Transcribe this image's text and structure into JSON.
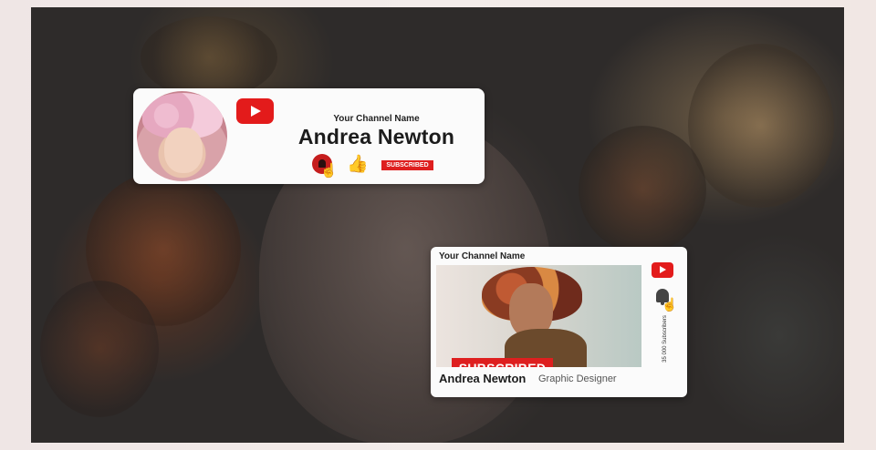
{
  "colors": {
    "accent_red": "#de1f1f",
    "youtube_red": "#e31b1b",
    "like_blue": "#3c7fd2",
    "card_bg": "#fbfbfb",
    "backdrop": "#2e2b2a"
  },
  "icons": {
    "youtube": "youtube-logo-icon",
    "bell": "notification-bell-icon",
    "like": "thumbs-up-icon",
    "cursor": "hand-pointer-icon"
  },
  "card_top": {
    "channel_label": "Your Channel Name",
    "name": "Andrea Newton",
    "subscribe_label": "SUBSCRIBED",
    "like_glyph": "👍",
    "cursor_glyph": "☝"
  },
  "card_bottom": {
    "channel_label": "Your Channel Name",
    "subscribe_label": "SUBSCRIBED",
    "subscriber_count": "35 000 Subscribers",
    "name": "Andrea Newton",
    "role": "Graphic Designer",
    "cursor_glyph": "☝"
  }
}
